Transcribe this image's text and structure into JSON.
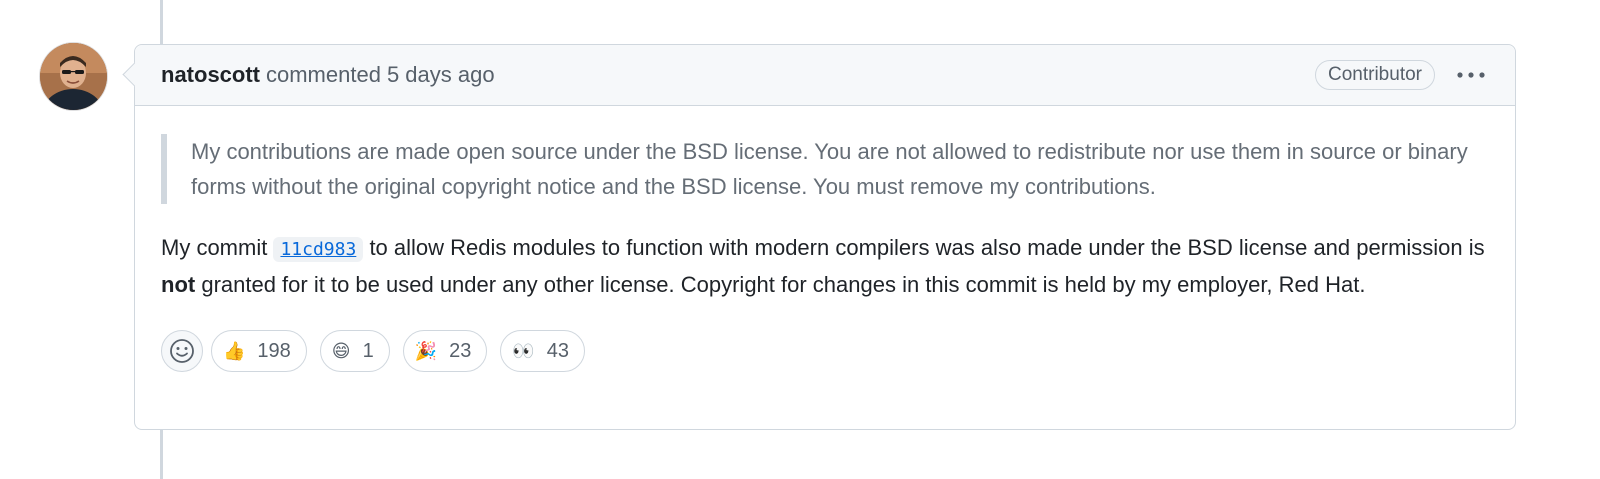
{
  "comment": {
    "author": "natoscott",
    "action": "commented",
    "time": "5 days ago",
    "role": "Contributor",
    "quote": "My contributions are made open source under the BSD license. You are not allowed to redistribute nor use them in source or binary forms without the original copyright notice and the BSD license. You must remove my contributions.",
    "body": {
      "part1": "My commit",
      "commit": "11cd983",
      "part2": "to allow Redis modules to function with modern compilers was also made under the BSD license and permission is",
      "emphasis": "not",
      "part3": "granted for it to be used under any other license. Copyright for changes in this commit is held by my employer, Red Hat."
    }
  },
  "reactions": [
    {
      "emoji": "👍",
      "count": "198"
    },
    {
      "emoji": "😄",
      "count": "1"
    },
    {
      "emoji": "🎉",
      "count": "23"
    },
    {
      "emoji": "👀",
      "count": "43"
    }
  ],
  "icons": {
    "more": "kebab-horizontal-icon",
    "add_reaction": "smiley-icon"
  },
  "colors": {
    "link": "#0969da",
    "border": "#d0d7de",
    "header_bg": "#f6f8fa"
  }
}
